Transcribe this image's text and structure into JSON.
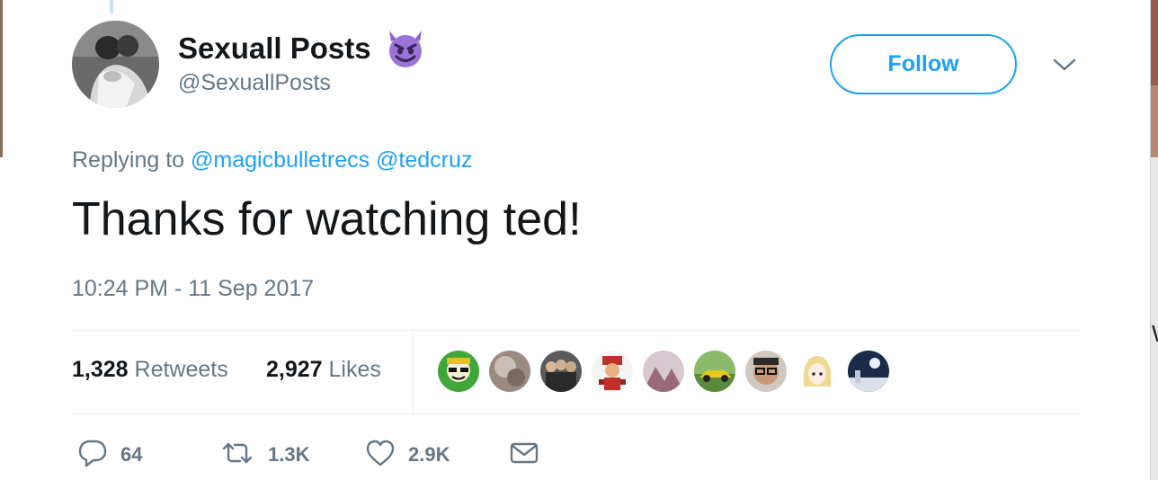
{
  "tweet": {
    "display_name": "Sexuall Posts",
    "name_emoji": "smiling-imp-emoji",
    "handle": "@SexuallPosts",
    "follow_label": "Follow",
    "replying_prefix": "Replying to",
    "mentions": [
      "@magicbulletrecs",
      "@tedcruz"
    ],
    "text": "Thanks for watching ted!",
    "timestamp": "10:24 PM - 11 Sep 2017"
  },
  "stats": {
    "retweets_count": "1,328",
    "retweets_label": "Retweets",
    "likes_count": "2,927",
    "likes_label": "Likes"
  },
  "likers": [
    {
      "icon": "cartoon-sunglasses-avatar",
      "color": "#3fa63a"
    },
    {
      "icon": "blurry-photo-avatar",
      "color": "#9a8a80"
    },
    {
      "icon": "group-photo-avatar",
      "color": "#4a4a4a"
    },
    {
      "icon": "mario-avatar",
      "color": "#c0302a"
    },
    {
      "icon": "landscape-avatar",
      "color": "#b89aa0"
    },
    {
      "icon": "yellow-car-avatar",
      "color": "#d8c020"
    },
    {
      "icon": "glasses-man-avatar",
      "color": "#6a5a50"
    },
    {
      "icon": "anime-blonde-avatar",
      "color": "#f0e0a0"
    },
    {
      "icon": "night-sky-avatar",
      "color": "#2a3a5a"
    }
  ],
  "actions": {
    "replies": "64",
    "retweets": "1.3K",
    "likes": "2.9K"
  },
  "colors": {
    "accent": "#1da1f2",
    "secondary_text": "#657786",
    "primary_text": "#14171a",
    "divider": "#e6ecf0"
  }
}
